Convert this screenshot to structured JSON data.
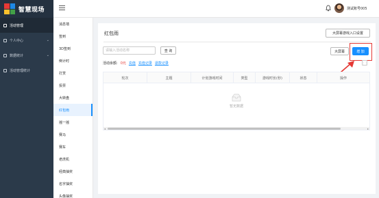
{
  "app": {
    "title": "智慧现场"
  },
  "sidebar": {
    "items": [
      {
        "label": "活动管理",
        "active": true
      },
      {
        "label": "个人中心",
        "chevron": "⌄"
      },
      {
        "label": "数据统计",
        "chevron": "⌄"
      },
      {
        "label": "活动管理统计"
      }
    ]
  },
  "header": {
    "user": "测试账号005",
    "icons": [
      "hamburger-icon",
      "bell-icon",
      "avatar"
    ]
  },
  "submenu": {
    "items": [
      "消息墙",
      "签到",
      "3D签到",
      "倒计时",
      "打赏",
      "投票",
      "大转盘",
      "红包雨",
      "摇一摇",
      "赛马",
      "赛车",
      "老虎机",
      "经典抽奖",
      "名字抽奖",
      "头像抽奖"
    ],
    "active_index": 7
  },
  "main": {
    "title": "红包雨",
    "screen_button": "大屏幕游戏入口设置",
    "search": {
      "placeholder": "请输入活动名称",
      "value": ""
    },
    "query_button": "查 询",
    "big_screen_button": "大屏幕",
    "add_button": "增 加",
    "balance_label": "活动余额:",
    "balance_amount": "0元",
    "links": [
      "充值",
      "充值记录",
      "退款记录"
    ],
    "columns": [
      "轮次",
      "主题",
      "计划游戏时间",
      "类型",
      "游戏时长(秒)",
      "状态",
      "操作"
    ],
    "empty_text": "暂无数据"
  },
  "colors": {
    "primary": "#1890ff",
    "sidebar": "#2b3a4a",
    "annotation": "#e53935"
  }
}
